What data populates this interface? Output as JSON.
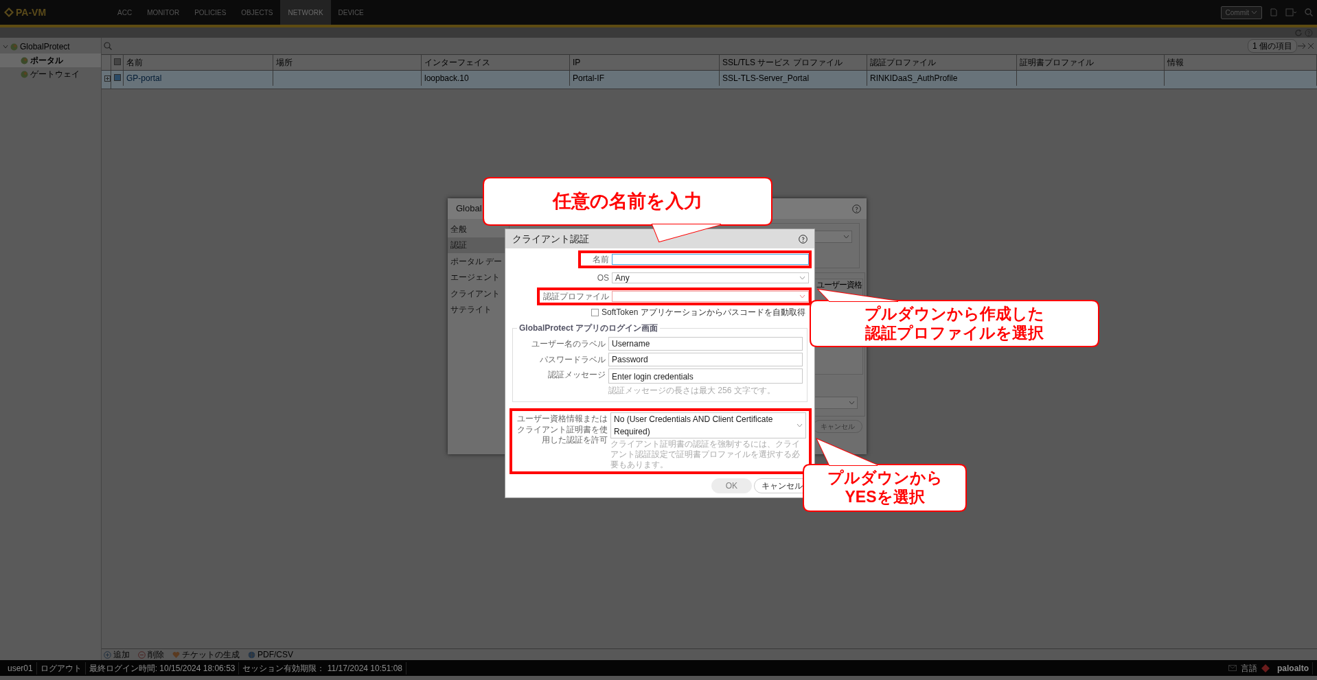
{
  "topbar": {
    "logo": "PA-VM",
    "tabs": [
      {
        "label": "ACC",
        "selected": false
      },
      {
        "label": "MONITOR",
        "selected": false
      },
      {
        "label": "POLICIES",
        "selected": false
      },
      {
        "label": "OBJECTS",
        "selected": false
      },
      {
        "label": "NETWORK",
        "selected": true
      },
      {
        "label": "DEVICE",
        "selected": false
      }
    ],
    "commit": "Commit"
  },
  "sidebar": {
    "items": [
      {
        "label": "GlobalProtect",
        "expanded": true,
        "children": [
          {
            "label": "ポータル",
            "selected": true
          },
          {
            "label": "ゲートウェイ",
            "selected": false
          }
        ]
      }
    ]
  },
  "table": {
    "count": "1 個の項目",
    "all_selected": false,
    "columns": [
      "名前",
      "場所",
      "インターフェイス",
      "IP",
      "SSL/TLS サービス プロファイル",
      "認証プロファイル",
      "証明書プロファイル",
      "情報"
    ],
    "rows": [
      {
        "checked": true,
        "cells": [
          "GP-portal",
          "",
          "loopback.10",
          "Portal-IF",
          "SSL-TLS-Server_Portal",
          "RINKIDaaS_AuthProfile",
          "",
          ""
        ]
      }
    ]
  },
  "actions": [
    "追加",
    "削除",
    "チケットの生成",
    "PDF/CSV"
  ],
  "status_bar": {
    "user": "user01",
    "items": [
      "ログアウト",
      "最終ログイン時間: 10/15/2024 18:06:53",
      "セッション有効期限： 11/17/2024 10:51:08"
    ],
    "language": "言語",
    "brand": "paloalto"
  },
  "portal_dialog": {
    "title": "Global",
    "nav": [
      {
        "label": "全般",
        "selected": false
      },
      {
        "label": "認証",
        "selected": true
      },
      {
        "label": "ポータル デー",
        "selected": false
      },
      {
        "label": "エージェント",
        "selected": false
      },
      {
        "label": "クライアント",
        "selected": false
      },
      {
        "label": "サテライト",
        "selected": false
      }
    ],
    "column_header": "ユーザー資格",
    "cancel": "キャンセル"
  },
  "client_auth_dialog": {
    "title": "クライアント認証",
    "fields": [
      {
        "kind": "text",
        "label": "名前",
        "focused": true,
        "highlighted": true
      },
      {
        "kind": "select",
        "label": "OS",
        "value": "Any",
        "highlighted": false
      },
      {
        "kind": "select",
        "label": "認証プロファイル",
        "invalid": true,
        "highlighted": true
      },
      {
        "kind": "checkbox",
        "label": "SoftToken アプリケーションからパスコードを自動取得",
        "checked": false,
        "highlighted": false
      }
    ],
    "login_screen": {
      "legend": "GlobalProtect アプリのログイン画面",
      "fields": [
        {
          "kind": "text",
          "label": "ユーザー名のラベル",
          "value": "Username"
        },
        {
          "kind": "text",
          "label": "パスワードラベル",
          "value": "Password"
        },
        {
          "kind": "textarea",
          "label": "認証メッセージ",
          "value": "Enter login credentials",
          "hint": "認証メッセージの長さは最大 256 文字です。"
        }
      ]
    },
    "allow_auth": {
      "kind": "select",
      "label": "ユーザー資格情報またはクライアント証明書を使用した認証を許可",
      "value": "No (User Credentials AND Client Certificate Required)",
      "hint": "クライアント証明書の認証を強制するには、クライアント認証設定で証明書プロファイルを選択する必要もあります。",
      "highlighted": true
    },
    "buttons": [
      {
        "label": "OK",
        "disabled": true
      },
      {
        "label": "キャンセル",
        "disabled": false
      }
    ]
  },
  "callouts": [
    {
      "lines": [
        "任意の名前を入力"
      ]
    },
    {
      "lines": [
        "プルダウンから作成した",
        "認証プロファイルを選択"
      ]
    },
    {
      "lines": [
        "プルダウンから",
        "YESを選択"
      ]
    }
  ]
}
